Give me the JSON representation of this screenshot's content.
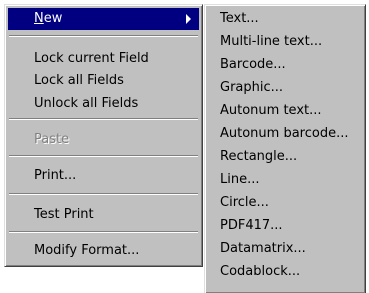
{
  "main_menu": {
    "new": {
      "mnemonic": "N",
      "rest": "ew"
    },
    "lock_current_field": "Lock current Field",
    "lock_all_fields": "Lock all Fields",
    "unlock_all_fields": "Unlock all Fields",
    "paste": "Paste",
    "print": "Print...",
    "test_print": "Test Print",
    "modify_format": "Modify Format..."
  },
  "submenu": {
    "items": [
      "Text...",
      "Multi-line text...",
      "Barcode...",
      "Graphic...",
      "Autonum text...",
      "Autonum barcode...",
      "Rectangle...",
      "Line...",
      "Circle...",
      "PDF417...",
      "Datamatrix...",
      "Codablock..."
    ]
  },
  "colors": {
    "menu_bg": "#c0c0c0",
    "highlight": "#000080",
    "disabled_text": "#808080"
  },
  "icons": [
    "submenu-arrow-icon"
  ]
}
